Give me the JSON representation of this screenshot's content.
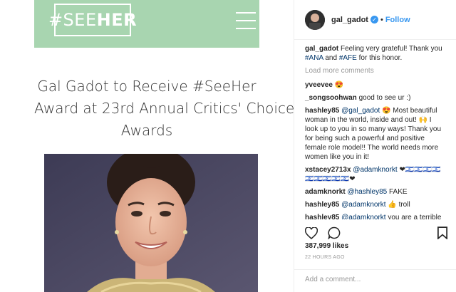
{
  "banner": {
    "logo_light": "#SEE",
    "logo_bold": "HER",
    "bg_color": "#a8d5b0"
  },
  "article": {
    "headline_lines": [
      "Gal Gadot to Receive #SeeHer",
      "Award at 23rd Annual Critics' Choice",
      "Awards"
    ]
  },
  "post": {
    "username": "gal_gadot",
    "follow_label": "Follow",
    "dot": "•",
    "caption": {
      "user": "gal_gadot",
      "text": "Feeling very grateful! Thank you",
      "tag1": "#ANA",
      "mid": "and",
      "tag2": "#AFE",
      "end": "for this honor."
    },
    "load_more": "Load more comments",
    "comments": [
      {
        "user": "yveevee",
        "text": "😍"
      },
      {
        "user": "_songsoohwan",
        "text": "good to see ur :)"
      },
      {
        "user": "hashley85",
        "mention": "@gal_gadot",
        "text": "😍 Most beautiful woman in the world, inside and out! 🙌 I look up to you in so many ways! Thank you for being such a powerful and positive female role model!! The world needs more women like you in it!"
      },
      {
        "user": "xstacey2713x",
        "mention": "@adamknorkt",
        "text": "❤🇮🇱🇮🇱🇮🇱🇮🇱🇮🇱🇮🇱🇮🇱🇮🇱🇮🇱❤"
      },
      {
        "user": "adamknorkt",
        "mention": "@hashley85",
        "text": "FAKE"
      },
      {
        "user": "hashley85",
        "mention": "@adamknorkt",
        "text": "👍 troll"
      },
      {
        "user": "hashley85",
        "mention": "@adamknorkt",
        "text": "you are a terrible human being"
      }
    ],
    "likes": "387,999 likes",
    "time": "22 HOURS AGO",
    "add_comment_placeholder": "Add a comment..."
  },
  "icons": {
    "like": "heart-icon",
    "comment": "comment-icon",
    "save": "bookmark-icon",
    "menu": "hamburger-menu-icon",
    "verified": "verified-badge-icon"
  },
  "colors": {
    "link": "#3897f0",
    "tag": "#003569",
    "muted": "#999999"
  }
}
